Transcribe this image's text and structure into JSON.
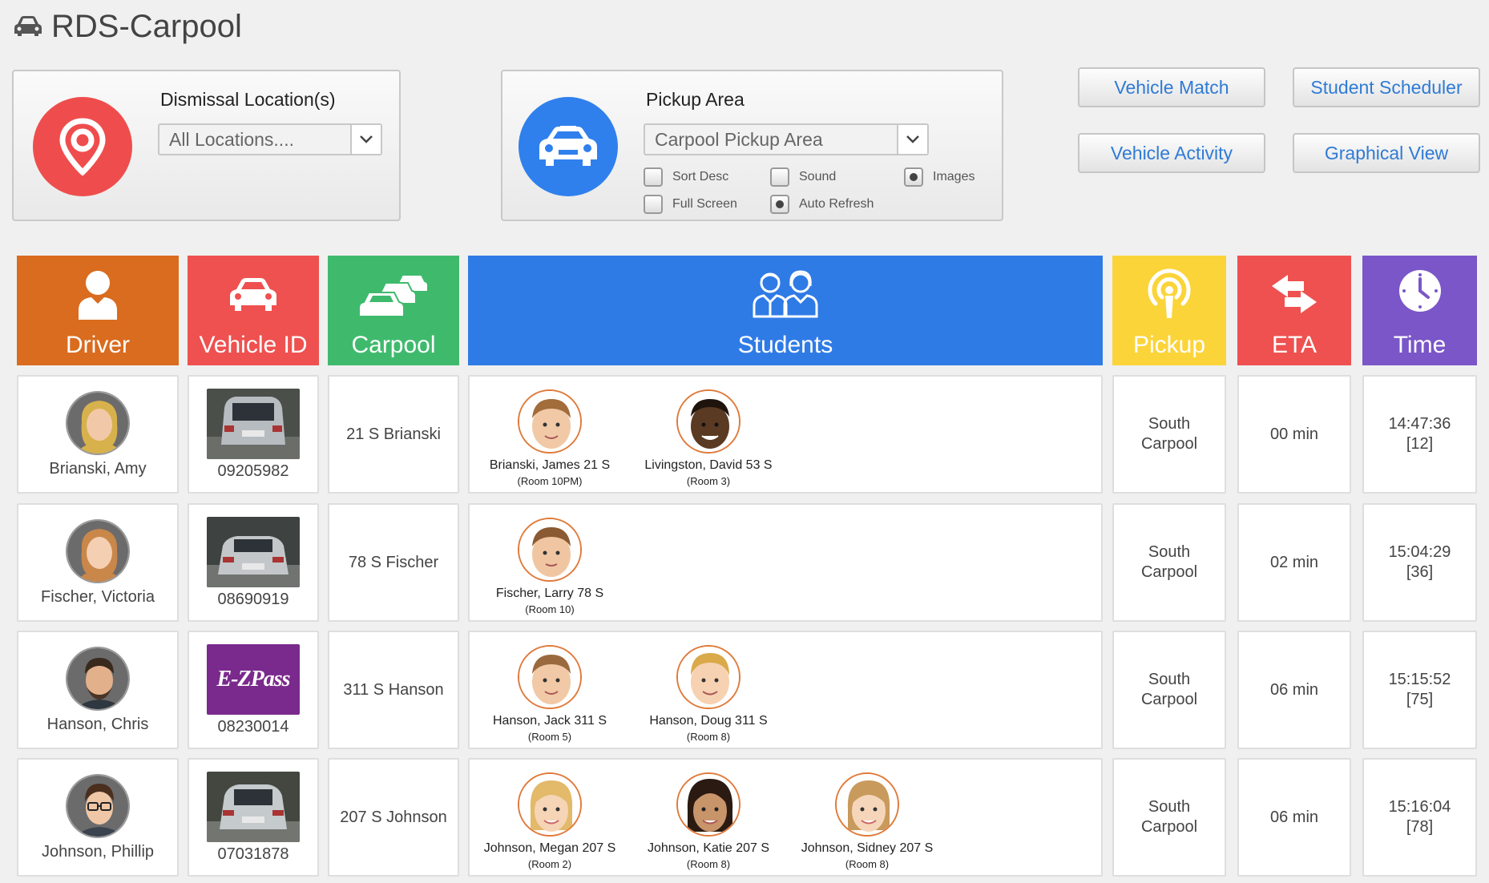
{
  "app": {
    "title": "RDS-Carpool",
    "title_icon": "car-icon"
  },
  "dismissal": {
    "label": "Dismissal Location(s)",
    "selected": "All Locations....",
    "icon": "map-pin-icon",
    "color": "#ef4d4d"
  },
  "pickup_area": {
    "label": "Pickup Area",
    "selected": "Carpool Pickup Area",
    "icon": "car-front-icon",
    "color": "#2f80ed",
    "options": [
      {
        "label": "Sort Desc",
        "checked": false
      },
      {
        "label": "Sound",
        "checked": false
      },
      {
        "label": "Images",
        "checked": true
      },
      {
        "label": "Full Screen",
        "checked": false
      },
      {
        "label": "Auto Refresh",
        "checked": true
      }
    ]
  },
  "buttons": {
    "vehicle_match": "Vehicle Match",
    "student_scheduler": "Student Scheduler",
    "vehicle_activity": "Vehicle Activity",
    "graphical_view": "Graphical View"
  },
  "columns": [
    {
      "label": "Driver",
      "color": "#d96c1f",
      "icon": "person-icon"
    },
    {
      "label": "Vehicle ID",
      "color": "#ee5150",
      "icon": "car-icon"
    },
    {
      "label": "Carpool",
      "color": "#3fba6d",
      "icon": "cars-icon"
    },
    {
      "label": "Students",
      "color": "#2f7be6",
      "icon": "students-icon"
    },
    {
      "label": "Pickup",
      "color": "#fbd43a",
      "icon": "pickup-signal-icon"
    },
    {
      "label": "ETA",
      "color": "#ee5150",
      "icon": "arrows-icon"
    },
    {
      "label": "Time",
      "color": "#7a56c8",
      "icon": "clock-icon"
    }
  ],
  "rows": [
    {
      "driver": "Brianski, Amy",
      "vehicle_id": "09205982",
      "vehicle_image": "silver-suv",
      "carpool": "21 S Brianski",
      "students": [
        {
          "name": "Brianski, James 21 S",
          "room": "(Room 10PM)"
        },
        {
          "name": "Livingston, David 53 S",
          "room": "(Room 3)"
        }
      ],
      "pickup_line1": "South",
      "pickup_line2": "Carpool",
      "eta": "00 min",
      "time": "14:47:36",
      "time_seq": "[12]"
    },
    {
      "driver": "Fischer, Victoria",
      "vehicle_id": "08690919",
      "vehicle_image": "silver-sedan",
      "carpool": "78 S Fischer",
      "students": [
        {
          "name": "Fischer, Larry 78 S",
          "room": "(Room 10)"
        }
      ],
      "pickup_line1": "South",
      "pickup_line2": "Carpool",
      "eta": "02 min",
      "time": "15:04:29",
      "time_seq": "[36]"
    },
    {
      "driver": "Hanson, Chris",
      "vehicle_id": "08230014",
      "vehicle_image": "ezpass",
      "vehicle_badge": "E-ZPass",
      "carpool": "311 S Hanson",
      "students": [
        {
          "name": "Hanson, Jack 311 S",
          "room": "(Room 5)"
        },
        {
          "name": "Hanson, Doug 311 S",
          "room": "(Room 8)"
        }
      ],
      "pickup_line1": "South",
      "pickup_line2": "Carpool",
      "eta": "06 min",
      "time": "15:15:52",
      "time_seq": "[75]"
    },
    {
      "driver": "Johnson, Phillip",
      "vehicle_id": "07031878",
      "vehicle_image": "silver-hatch",
      "carpool": "207 S Johnson",
      "students": [
        {
          "name": "Johnson, Megan 207 S",
          "room": "(Room 2)"
        },
        {
          "name": "Johnson, Katie 207 S",
          "room": "(Room 8)"
        },
        {
          "name": "Johnson, Sidney 207 S",
          "room": "(Room 8)"
        }
      ],
      "pickup_line1": "South",
      "pickup_line2": "Carpool",
      "eta": "06 min",
      "time": "15:16:04",
      "time_seq": "[78]"
    }
  ]
}
